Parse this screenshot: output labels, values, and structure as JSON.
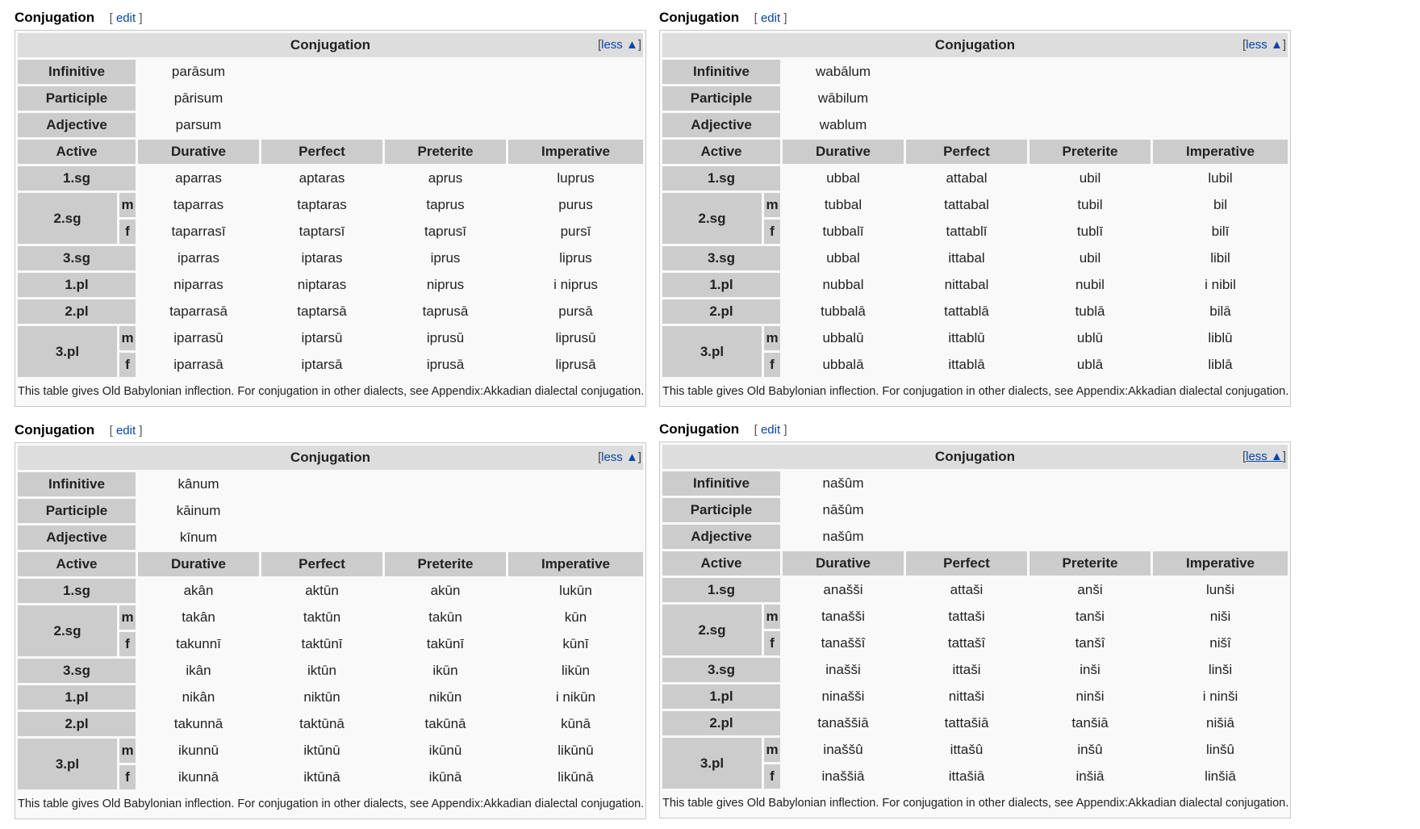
{
  "common": {
    "section_heading": "Conjugation",
    "edit_open": "[",
    "edit_label": "edit",
    "edit_close": "]",
    "table_title": "Conjugation",
    "less_open": "[",
    "less_label": "less ▲",
    "less_close": "]",
    "labels": {
      "infinitive": "Infinitive",
      "participle": "Participle",
      "adjective": "Adjective",
      "active": "Active"
    },
    "columns": [
      "Durative",
      "Perfect",
      "Preterite",
      "Imperative"
    ],
    "persons": {
      "sg1": "1.sg",
      "sg2": "2.sg",
      "sg3": "3.sg",
      "pl1": "1.pl",
      "pl2": "2.pl",
      "pl3": "3.pl",
      "m": "m",
      "f": "f"
    },
    "footnote": "This table gives Old Babylonian inflection. For conjugation in other dialects, see Appendix:Akkadian dialectal conjugation."
  },
  "tables": [
    {
      "infinitive": "parāsum",
      "participle": "pārisum",
      "adjective": "parsum",
      "rows": {
        "sg1": [
          "aparras",
          "aptaras",
          "aprus",
          "luprus"
        ],
        "sg2m": [
          "taparras",
          "taptaras",
          "taprus",
          "purus"
        ],
        "sg2f": [
          "taparrasī",
          "taptarsī",
          "taprusī",
          "pursī"
        ],
        "sg3": [
          "iparras",
          "iptaras",
          "iprus",
          "liprus"
        ],
        "pl1": [
          "niparras",
          "niptaras",
          "niprus",
          "i niprus"
        ],
        "pl2": [
          "taparrasā",
          "taptarsā",
          "taprusā",
          "pursā"
        ],
        "pl3m": [
          "iparrasū",
          "iptarsū",
          "iprusū",
          "liprusū"
        ],
        "pl3f": [
          "iparrasā",
          "iptarsā",
          "iprusā",
          "liprusā"
        ]
      }
    },
    {
      "infinitive": "wabālum",
      "participle": "wābilum",
      "adjective": "wablum",
      "rows": {
        "sg1": [
          "ubbal",
          "attabal",
          "ubil",
          "lubil"
        ],
        "sg2m": [
          "tubbal",
          "tattabal",
          "tubil",
          "bil"
        ],
        "sg2f": [
          "tubbalī",
          "tattablī",
          "tublī",
          "bilī"
        ],
        "sg3": [
          "ubbal",
          "ittabal",
          "ubil",
          "libil"
        ],
        "pl1": [
          "nubbal",
          "nittabal",
          "nubil",
          "i nibil"
        ],
        "pl2": [
          "tubbalā",
          "tattablā",
          "tublā",
          "bilā"
        ],
        "pl3m": [
          "ubbalū",
          "ittablū",
          "ublū",
          "liblū"
        ],
        "pl3f": [
          "ubbalā",
          "ittablā",
          "ublā",
          "liblā"
        ]
      }
    },
    {
      "infinitive": "kânum",
      "participle": "kāinum",
      "adjective": "kīnum",
      "rows": {
        "sg1": [
          "akân",
          "aktūn",
          "akūn",
          "lukūn"
        ],
        "sg2m": [
          "takân",
          "taktūn",
          "takūn",
          "kūn"
        ],
        "sg2f": [
          "takunnī",
          "taktūnī",
          "takūnī",
          "kūnī"
        ],
        "sg3": [
          "ikân",
          "iktūn",
          "ikūn",
          "likūn"
        ],
        "pl1": [
          "nikân",
          "niktūn",
          "nikūn",
          "i nikūn"
        ],
        "pl2": [
          "takunnā",
          "taktūnā",
          "takūnā",
          "kūnā"
        ],
        "pl3m": [
          "ikunnū",
          "iktūnū",
          "ikūnū",
          "likūnū"
        ],
        "pl3f": [
          "ikunnā",
          "iktūnā",
          "ikūnā",
          "likūnā"
        ]
      }
    },
    {
      "infinitive": "našûm",
      "participle": "nāšûm",
      "adjective": "našûm",
      "rows": {
        "sg1": [
          "anašši",
          "attaši",
          "anši",
          "lunši"
        ],
        "sg2m": [
          "tanašši",
          "tattaši",
          "tanši",
          "niši"
        ],
        "sg2f": [
          "tanaššî",
          "tattašî",
          "tanšî",
          "nišî"
        ],
        "sg3": [
          "inašši",
          "ittaši",
          "inši",
          "linši"
        ],
        "pl1": [
          "ninašši",
          "nittaši",
          "ninši",
          "i ninši"
        ],
        "pl2": [
          "tanaššiā",
          "tattašiā",
          "tanšiā",
          "nišiā"
        ],
        "pl3m": [
          "inaššû",
          "ittašû",
          "inšû",
          "linšû"
        ],
        "pl3f": [
          "inaššiā",
          "ittašiā",
          "inšiā",
          "linšiā"
        ]
      }
    }
  ],
  "colors": {
    "link": "#0645ad",
    "header_cell": "#cccccc",
    "title_bar": "#dddddd",
    "table_bg": "#f9f9f9",
    "border": "#c8c8c8"
  }
}
